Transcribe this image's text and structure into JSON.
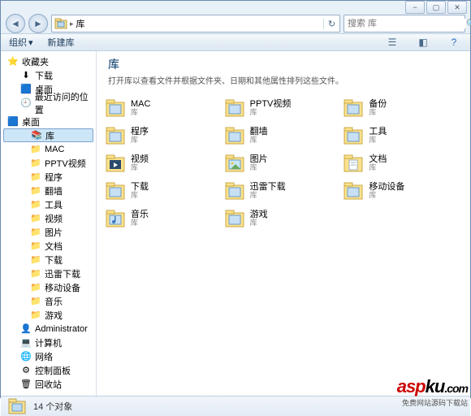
{
  "titlebar": {
    "min": "−",
    "max": "▢",
    "close": "✕"
  },
  "nav": {
    "back": "◄",
    "forward": "►",
    "refresh": "↻"
  },
  "address": {
    "path": "库",
    "arrow": "▸"
  },
  "search": {
    "placeholder": "搜索 库",
    "icon": "🔍"
  },
  "toolbar": {
    "organize": "组织",
    "newlib": "新建库",
    "view_icon": "☰",
    "help_icon": "?"
  },
  "sidebar": {
    "favorites": {
      "head": "收藏夹",
      "items": [
        "下载",
        "桌面",
        "最近访问的位置"
      ]
    },
    "desktop": {
      "head": "桌面",
      "lib": "库",
      "lib_items": [
        "MAC",
        "PPTV视频",
        "程序",
        "翻墙",
        "工具",
        "视频",
        "图片",
        "文档",
        "下载",
        "迅雷下载",
        "移动设备",
        "音乐",
        "游戏"
      ],
      "admin": "Administrator",
      "computer": "计算机",
      "network": "网络",
      "control": "控制面板",
      "recycle": "回收站"
    }
  },
  "main": {
    "title": "库",
    "desc": "打开库以查看文件并根据文件夹、日期和其他属性排列这些文件。",
    "items": [
      {
        "name": "MAC",
        "sub": "库",
        "icon": "lib"
      },
      {
        "name": "PPTV视频",
        "sub": "库",
        "icon": "lib"
      },
      {
        "name": "备份",
        "sub": "库",
        "icon": "lib"
      },
      {
        "name": "程序",
        "sub": "库",
        "icon": "lib"
      },
      {
        "name": "翻墙",
        "sub": "库",
        "icon": "lib"
      },
      {
        "name": "工具",
        "sub": "库",
        "icon": "lib"
      },
      {
        "name": "视频",
        "sub": "库",
        "icon": "video"
      },
      {
        "name": "图片",
        "sub": "库",
        "icon": "pic"
      },
      {
        "name": "文档",
        "sub": "库",
        "icon": "doc"
      },
      {
        "name": "下载",
        "sub": "库",
        "icon": "lib"
      },
      {
        "name": "迅雷下载",
        "sub": "库",
        "icon": "lib"
      },
      {
        "name": "移动设备",
        "sub": "库",
        "icon": "lib"
      },
      {
        "name": "音乐",
        "sub": "库",
        "icon": "music"
      },
      {
        "name": "游戏",
        "sub": "库",
        "icon": "lib"
      }
    ]
  },
  "status": {
    "count": "14 个对象"
  },
  "watermark": {
    "r": "asp",
    "b": "ku",
    "com": ".com",
    "sub": "免费网站源码下载站"
  }
}
